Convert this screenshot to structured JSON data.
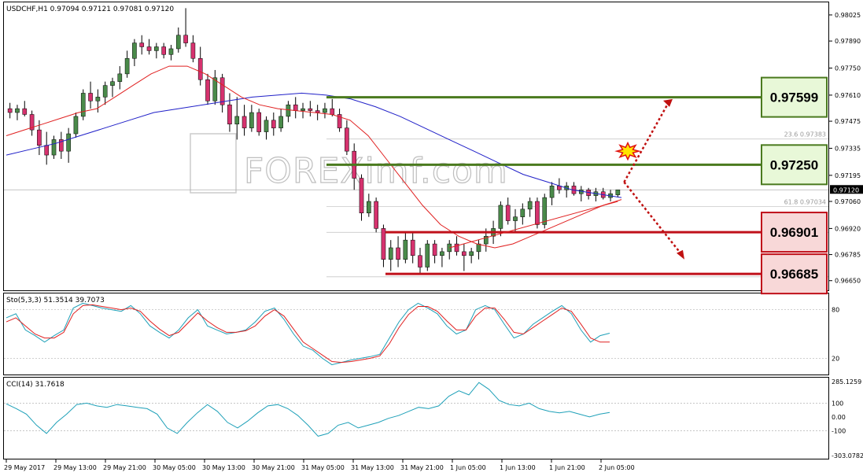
{
  "header": {
    "symbol_info": "USDCHF,H1  0.97094 0.97121 0.97081 0.97120",
    "watermark": "FOREXimf.com"
  },
  "colors": {
    "bull": "#4a8a4a",
    "bear": "#d6326e",
    "ema_fast": "#e02020",
    "ema_slow": "#2020c8",
    "resistance": "#4a7a1e",
    "support": "#c0101a",
    "res_box": "#e8f8d8",
    "sup_box": "#f8d8d8",
    "arrow": "#c01010",
    "stoch_main": "#1ea0b8",
    "stoch_signal": "#e02020",
    "cci": "#1ea0b8"
  },
  "chart_data": [
    {
      "type": "candlestick",
      "title": "USDCHF,H1",
      "ohlc_text": "0.97094 0.97121 0.97081 0.97120",
      "ylim": [
        0.966,
        0.9809
      ],
      "y_ticks": [
        "0.98025",
        "0.97890",
        "0.97750",
        "0.97610",
        "0.97475",
        "0.97335",
        "0.97195",
        "0.97060",
        "0.96920",
        "0.96785",
        "0.96650"
      ],
      "current_price": "0.97120",
      "x_labels": [
        "29 May 2017",
        "29 May 13:00",
        "29 May 21:00",
        "30 May 05:00",
        "30 May 13:00",
        "30 May 21:00",
        "31 May 05:00",
        "31 May 13:00",
        "31 May 21:00",
        "1 Jun 05:00",
        "1 Jun 13:00",
        "1 Jun 21:00",
        "2 Jun 05:00"
      ],
      "ohlc": [
        [
          0.9754,
          0.9757,
          0.9749,
          0.9752
        ],
        [
          0.9752,
          0.9756,
          0.9748,
          0.9754
        ],
        [
          0.9754,
          0.9758,
          0.975,
          0.9751
        ],
        [
          0.9751,
          0.9753,
          0.974,
          0.9743
        ],
        [
          0.9743,
          0.9748,
          0.973,
          0.9735
        ],
        [
          0.9735,
          0.9742,
          0.9725,
          0.973
        ],
        [
          0.973,
          0.974,
          0.9728,
          0.9738
        ],
        [
          0.9738,
          0.9742,
          0.9728,
          0.9732
        ],
        [
          0.9732,
          0.9744,
          0.9726,
          0.9741
        ],
        [
          0.9741,
          0.9752,
          0.9739,
          0.975
        ],
        [
          0.975,
          0.9764,
          0.9748,
          0.9762
        ],
        [
          0.9762,
          0.9768,
          0.9754,
          0.9758
        ],
        [
          0.9758,
          0.9764,
          0.9752,
          0.976
        ],
        [
          0.976,
          0.9768,
          0.9756,
          0.9766
        ],
        [
          0.9766,
          0.977,
          0.976,
          0.9768
        ],
        [
          0.9768,
          0.9776,
          0.9764,
          0.9772
        ],
        [
          0.9772,
          0.9784,
          0.977,
          0.978
        ],
        [
          0.978,
          0.979,
          0.9776,
          0.9788
        ],
        [
          0.9788,
          0.9792,
          0.9782,
          0.9786
        ],
        [
          0.9786,
          0.979,
          0.9782,
          0.9784
        ],
        [
          0.9784,
          0.9788,
          0.978,
          0.9786
        ],
        [
          0.9786,
          0.9788,
          0.978,
          0.9782
        ],
        [
          0.9782,
          0.9787,
          0.9779,
          0.9785
        ],
        [
          0.9785,
          0.9796,
          0.9783,
          0.9792
        ],
        [
          0.9792,
          0.9806,
          0.9786,
          0.9788
        ],
        [
          0.9788,
          0.9792,
          0.9778,
          0.978
        ],
        [
          0.978,
          0.9786,
          0.9766,
          0.9769
        ],
        [
          0.9769,
          0.9772,
          0.9756,
          0.9758
        ],
        [
          0.9758,
          0.9774,
          0.9756,
          0.977
        ],
        [
          0.977,
          0.9772,
          0.9752,
          0.9756
        ],
        [
          0.9756,
          0.9762,
          0.9742,
          0.9746
        ],
        [
          0.9746,
          0.976,
          0.9738,
          0.975
        ],
        [
          0.975,
          0.9756,
          0.974,
          0.9744
        ],
        [
          0.9744,
          0.9756,
          0.9742,
          0.9752
        ],
        [
          0.9752,
          0.9754,
          0.974,
          0.9742
        ],
        [
          0.9742,
          0.975,
          0.9738,
          0.9748
        ],
        [
          0.9748,
          0.9752,
          0.974,
          0.9744
        ],
        [
          0.9744,
          0.9754,
          0.9742,
          0.975
        ],
        [
          0.975,
          0.9758,
          0.9747,
          0.9756
        ],
        [
          0.9756,
          0.976,
          0.9749,
          0.9753
        ],
        [
          0.9753,
          0.9757,
          0.9749,
          0.9754
        ],
        [
          0.9754,
          0.9758,
          0.975,
          0.9753
        ],
        [
          0.9753,
          0.9756,
          0.9748,
          0.9752
        ],
        [
          0.9752,
          0.9757,
          0.9749,
          0.9754
        ],
        [
          0.9754,
          0.9759,
          0.975,
          0.9751
        ],
        [
          0.9751,
          0.9754,
          0.9742,
          0.9744
        ],
        [
          0.9744,
          0.9748,
          0.973,
          0.9732
        ],
        [
          0.9732,
          0.9736,
          0.9712,
          0.9718
        ],
        [
          0.9718,
          0.972,
          0.9696,
          0.97
        ],
        [
          0.97,
          0.971,
          0.9698,
          0.9706
        ],
        [
          0.9706,
          0.9708,
          0.969,
          0.9692
        ],
        [
          0.9692,
          0.9694,
          0.9672,
          0.9676
        ],
        [
          0.9676,
          0.9686,
          0.967,
          0.9682
        ],
        [
          0.9682,
          0.9688,
          0.9672,
          0.9676
        ],
        [
          0.9676,
          0.969,
          0.9674,
          0.9686
        ],
        [
          0.9686,
          0.969,
          0.9674,
          0.9678
        ],
        [
          0.9678,
          0.9682,
          0.9668,
          0.9672
        ],
        [
          0.9672,
          0.9686,
          0.967,
          0.9684
        ],
        [
          0.9684,
          0.9686,
          0.9674,
          0.9678
        ],
        [
          0.9678,
          0.9682,
          0.9672,
          0.968
        ],
        [
          0.968,
          0.9686,
          0.9676,
          0.9684
        ],
        [
          0.9684,
          0.9688,
          0.9678,
          0.968
        ],
        [
          0.968,
          0.9684,
          0.967,
          0.9678
        ],
        [
          0.9678,
          0.9682,
          0.9674,
          0.968
        ],
        [
          0.968,
          0.9686,
          0.9676,
          0.9684
        ],
        [
          0.9684,
          0.9692,
          0.968,
          0.9688
        ],
        [
          0.9688,
          0.9696,
          0.9684,
          0.9692
        ],
        [
          0.9692,
          0.9706,
          0.9688,
          0.9704
        ],
        [
          0.9704,
          0.9708,
          0.9694,
          0.9696
        ],
        [
          0.9696,
          0.9702,
          0.969,
          0.9698
        ],
        [
          0.9698,
          0.9705,
          0.9694,
          0.9702
        ],
        [
          0.9702,
          0.9708,
          0.9698,
          0.9706
        ],
        [
          0.9706,
          0.9708,
          0.9692,
          0.9694
        ],
        [
          0.9694,
          0.971,
          0.9692,
          0.9708
        ],
        [
          0.9708,
          0.9716,
          0.9704,
          0.9714
        ],
        [
          0.9714,
          0.9718,
          0.971,
          0.9712
        ],
        [
          0.9712,
          0.9716,
          0.9708,
          0.9714
        ],
        [
          0.9714,
          0.9716,
          0.9709,
          0.971
        ],
        [
          0.971,
          0.9714,
          0.9706,
          0.9712
        ],
        [
          0.9712,
          0.9713,
          0.9707,
          0.9709
        ],
        [
          0.9709,
          0.9713,
          0.9706,
          0.9711
        ],
        [
          0.9711,
          0.9713,
          0.9707,
          0.9708
        ],
        [
          0.9708,
          0.9712,
          0.9706,
          0.971
        ],
        [
          0.97094,
          0.97121,
          0.97081,
          0.9712
        ]
      ],
      "ema_fast": [
        0.974,
        0.9743,
        0.9746,
        0.9749,
        0.9752,
        0.9754,
        0.976,
        0.9766,
        0.9772,
        0.9776,
        0.9776,
        0.9772,
        0.9766,
        0.976,
        0.9756,
        0.9754,
        0.9753,
        0.9752,
        0.9751,
        0.9748,
        0.974,
        0.9728,
        0.9716,
        0.9704,
        0.9694,
        0.9688,
        0.9684,
        0.9682,
        0.9684,
        0.9688,
        0.9692,
        0.9696,
        0.97,
        0.9704,
        0.9707
      ],
      "ema_slow": [
        0.973,
        0.9733,
        0.9736,
        0.974,
        0.9744,
        0.9748,
        0.9752,
        0.9754,
        0.9756,
        0.9758,
        0.976,
        0.9761,
        0.9762,
        0.9761,
        0.9759,
        0.9755,
        0.975,
        0.9744,
        0.9738,
        0.9732,
        0.9726,
        0.972,
        0.9716,
        0.9712,
        0.971,
        0.9708
      ],
      "fib_labels": [
        "23.6 0.97383",
        "61.8 0.97034"
      ],
      "levels": {
        "resistance": [
          "0.97599",
          "0.97250"
        ],
        "support": [
          "0.96901",
          "0.96685"
        ]
      }
    },
    {
      "type": "line",
      "title": "Sto(5,3,3) 51.3514 39.7073",
      "ylim": [
        0,
        100
      ],
      "y_ticks": [
        "80",
        "20"
      ],
      "series": [
        {
          "values": [
            70,
            75,
            55,
            48,
            40,
            48,
            55,
            82,
            88,
            85,
            82,
            80,
            78,
            85,
            75,
            60,
            52,
            45,
            55,
            70,
            80,
            60,
            55,
            50,
            52,
            55,
            65,
            78,
            82,
            68,
            50,
            35,
            30,
            20,
            12,
            15,
            18,
            20,
            22,
            25,
            45,
            65,
            80,
            88,
            82,
            75,
            60,
            50,
            55,
            80,
            85,
            80,
            62,
            45,
            50,
            62,
            70,
            78,
            85,
            75,
            55,
            40,
            48,
            51
          ]
        },
        {
          "values": [
            65,
            70,
            60,
            50,
            45,
            45,
            52,
            75,
            85,
            86,
            84,
            82,
            80,
            82,
            78,
            66,
            56,
            48,
            52,
            64,
            76,
            66,
            58,
            52,
            52,
            54,
            60,
            72,
            80,
            72,
            56,
            40,
            32,
            24,
            16,
            15,
            16,
            18,
            20,
            23,
            38,
            58,
            74,
            84,
            84,
            78,
            66,
            55,
            55,
            72,
            82,
            82,
            68,
            52,
            50,
            58,
            66,
            74,
            82,
            78,
            62,
            45,
            40,
            40
          ]
        }
      ]
    },
    {
      "type": "line",
      "title": "CCI(14) 31.7618",
      "ylim": [
        -303.0782,
        285.1259
      ],
      "y_ticks": [
        "285.1259",
        "100",
        "0.00",
        "-100",
        "-303.0782"
      ],
      "series": [
        {
          "values": [
            95,
            60,
            20,
            -60,
            -120,
            -40,
            20,
            90,
            100,
            80,
            70,
            90,
            80,
            70,
            60,
            20,
            -80,
            -120,
            -40,
            30,
            90,
            40,
            -40,
            -80,
            -30,
            30,
            80,
            90,
            60,
            10,
            -60,
            -140,
            -120,
            -60,
            -40,
            -80,
            -60,
            -40,
            -10,
            10,
            40,
            70,
            60,
            80,
            150,
            190,
            160,
            250,
            200,
            120,
            90,
            80,
            100,
            60,
            40,
            30,
            40,
            20,
            0,
            20,
            32
          ]
        }
      ]
    }
  ]
}
